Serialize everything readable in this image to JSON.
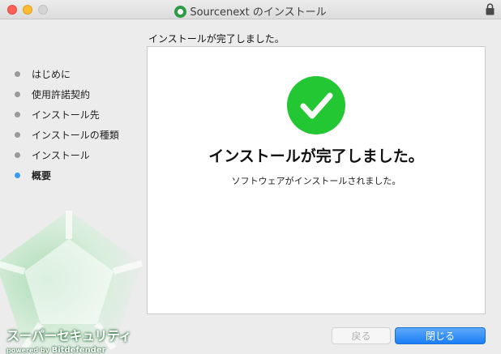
{
  "window": {
    "title": "Sourcenext のインストール"
  },
  "heading": "インストールが完了しました。",
  "steps": [
    {
      "label": "はじめに",
      "status": "done"
    },
    {
      "label": "使用許諾契約",
      "status": "done"
    },
    {
      "label": "インストール先",
      "status": "done"
    },
    {
      "label": "インストールの種類",
      "status": "done"
    },
    {
      "label": "インストール",
      "status": "done"
    },
    {
      "label": "概要",
      "status": "current"
    }
  ],
  "panel": {
    "big_title": "インストールが完了しました。",
    "sub_text": "ソフトウェアがインストールされました。"
  },
  "brand": {
    "title": "スーパーセキュリティ",
    "powered_by": "powered by",
    "partner": "Bitdefender"
  },
  "buttons": {
    "back": "戻る",
    "close": "閉じる"
  },
  "colors": {
    "accent": "#1a7ef5",
    "success": "#22c733",
    "active_step": "#3b9bf0"
  }
}
